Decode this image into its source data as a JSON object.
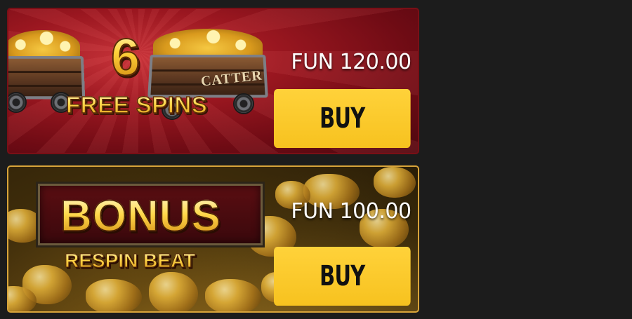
{
  "offers": [
    {
      "headline_number": "6",
      "headline_text": "FREE SPINS",
      "cart_label": "CATTER",
      "price": "FUN 120.00",
      "buy_label": "BUY"
    },
    {
      "headline_text": "BONUS",
      "sub_text": "RESPIN BEAT",
      "price": "FUN 100.00",
      "buy_label": "BUY"
    }
  ],
  "colors": {
    "background": "#1c1c1c",
    "button": "#f7c21f",
    "free_spins_panel": "#8e1820",
    "free_spins_border": "#7a0f16",
    "bonus_border": "#d8a43a"
  },
  "icons": [
    "mine-cart-icon",
    "gold-nuggets-icon"
  ]
}
